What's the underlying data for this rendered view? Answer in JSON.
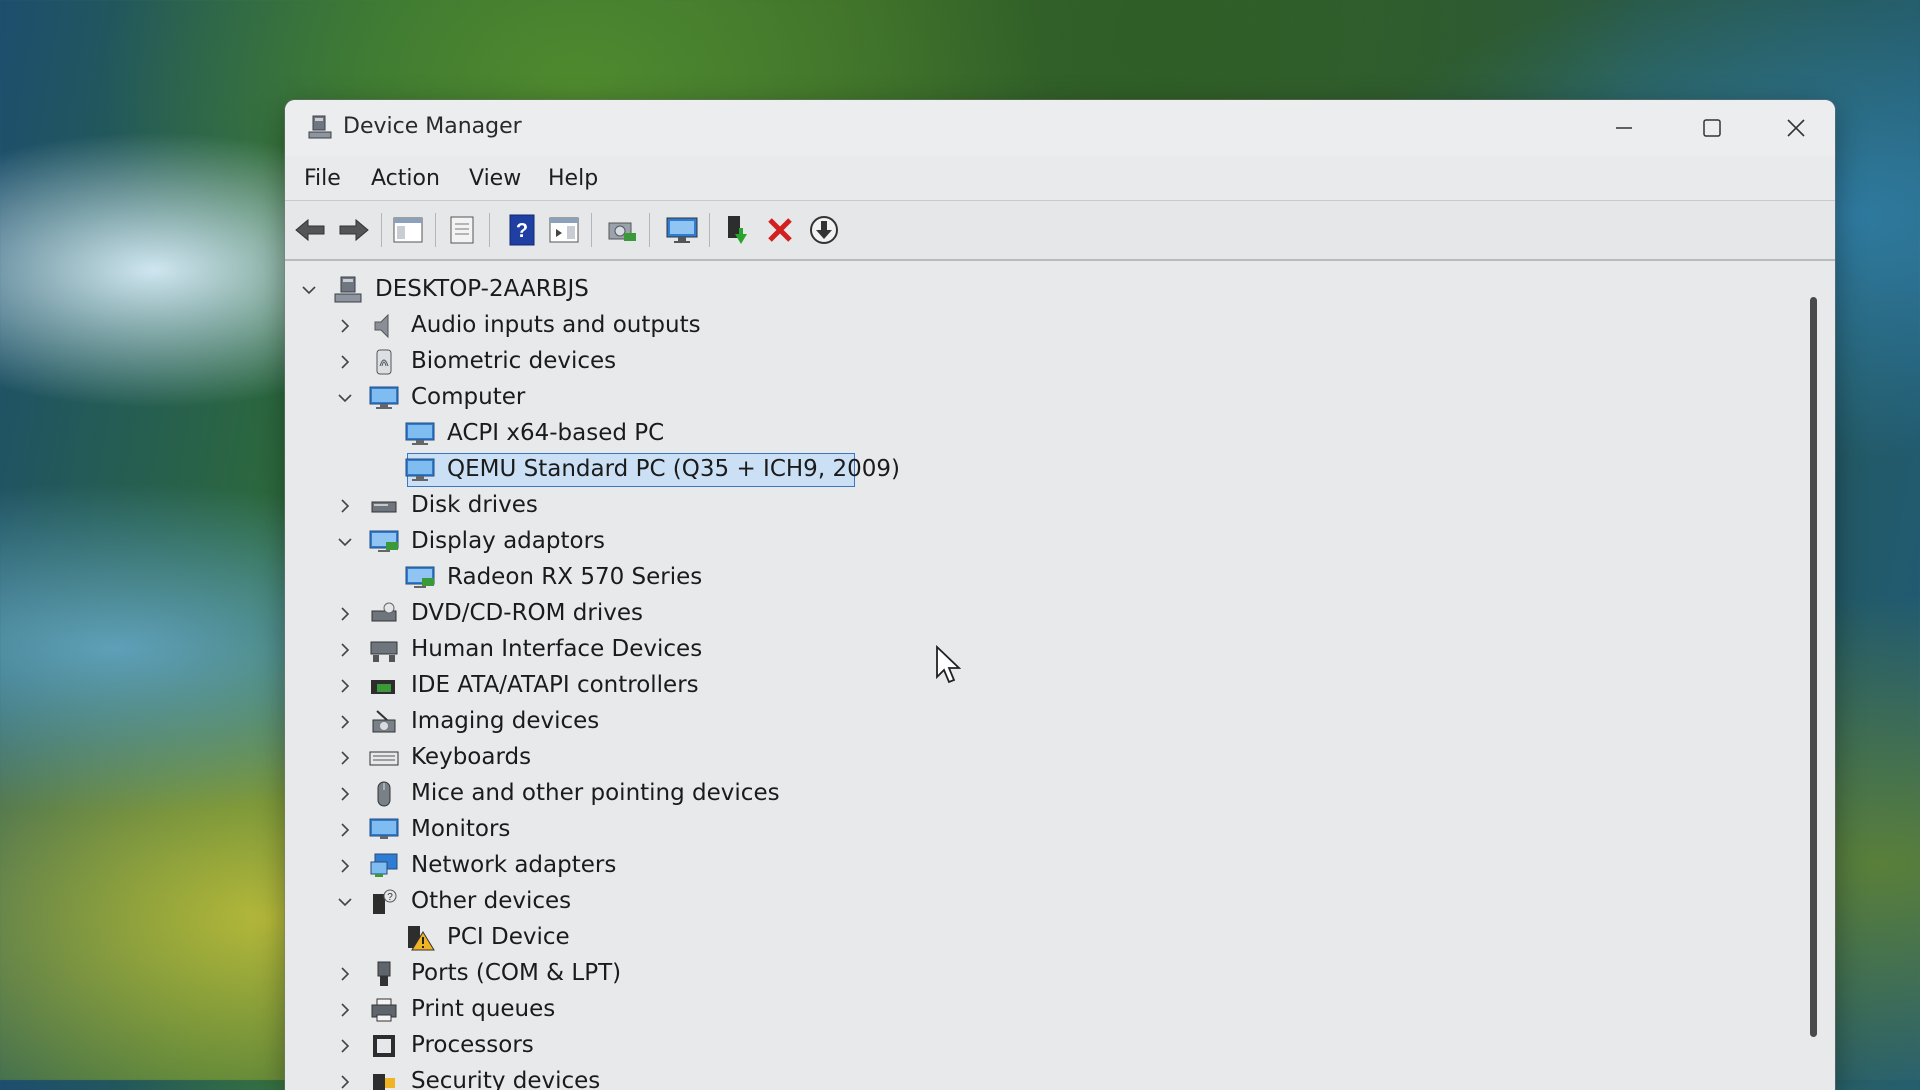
{
  "window": {
    "title": "Device Manager",
    "controls": {
      "minimize": "minimize",
      "maximize": "maximize",
      "close": "close"
    }
  },
  "menu": [
    "File",
    "Action",
    "View",
    "Help"
  ],
  "toolbar": [
    "back-icon",
    "forward-icon",
    "show-hide-console-tree-icon",
    "properties-icon",
    "help-icon",
    "action-pane-icon",
    "scan-hardware-icon",
    "monitor-icon",
    "update-driver-icon",
    "uninstall-icon",
    "disable-device-icon"
  ],
  "tree": {
    "root": "DESKTOP-2AARBJS",
    "items": [
      {
        "label": "Audio inputs and outputs",
        "expanded": false
      },
      {
        "label": "Biometric devices",
        "expanded": false
      },
      {
        "label": "Computer",
        "expanded": true
      },
      {
        "label": "ACPI x64-based PC",
        "child": true
      },
      {
        "label": "QEMU Standard PC (Q35 + ICH9, 2009)",
        "child": true,
        "selected": true
      },
      {
        "label": "Disk drives",
        "expanded": false
      },
      {
        "label": "Display adaptors",
        "expanded": true
      },
      {
        "label": "Radeon RX 570 Series",
        "child": true
      },
      {
        "label": "DVD/CD-ROM drives",
        "expanded": false
      },
      {
        "label": "Human Interface Devices",
        "expanded": false
      },
      {
        "label": "IDE ATA/ATAPI controllers",
        "expanded": false
      },
      {
        "label": "Imaging devices",
        "expanded": false
      },
      {
        "label": "Keyboards",
        "expanded": false
      },
      {
        "label": "Mice and other pointing devices",
        "expanded": false
      },
      {
        "label": "Monitors",
        "expanded": false
      },
      {
        "label": "Network adapters",
        "expanded": false
      },
      {
        "label": "Other devices",
        "expanded": true
      },
      {
        "label": "PCI Device",
        "child": true,
        "warning": true
      },
      {
        "label": "Ports (COM & LPT)",
        "expanded": false
      },
      {
        "label": "Print queues",
        "expanded": false
      },
      {
        "label": "Processors",
        "expanded": false
      },
      {
        "label": "Security devices",
        "expanded": false
      }
    ]
  },
  "colors": {
    "selection_fill": "#cce0f5",
    "selection_border": "#3a78c4",
    "uninstall_red": "#d21f1f"
  }
}
